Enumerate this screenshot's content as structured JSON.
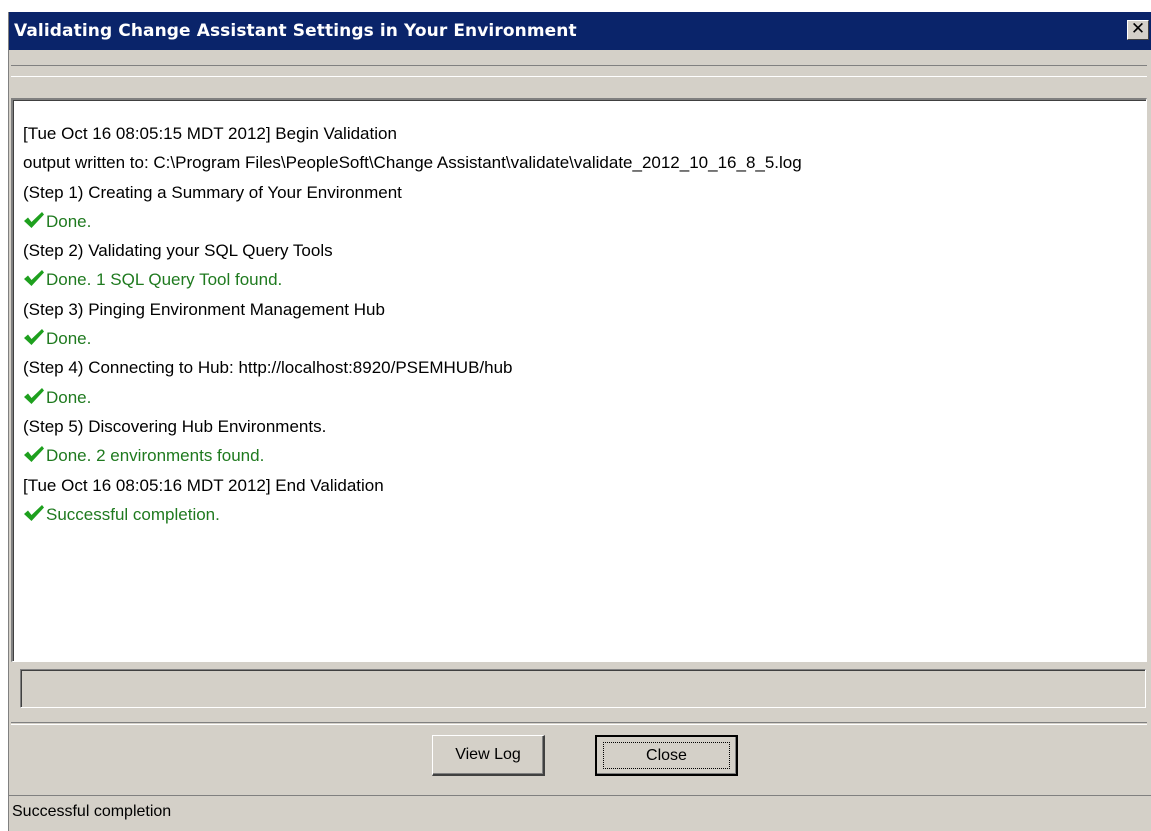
{
  "window": {
    "title": "Validating Change Assistant Settings in Your Environment",
    "close_glyph": "✕"
  },
  "log": {
    "lines": [
      {
        "text": "[Tue Oct 16 08:05:15 MDT 2012] Begin Validation",
        "status": "info"
      },
      {
        "text": "output written to: C:\\Program Files\\PeopleSoft\\Change Assistant\\validate\\validate_2012_10_16_8_5.log",
        "status": "info"
      },
      {
        "text": "(Step 1) Creating a Summary of Your Environment",
        "status": "info"
      },
      {
        "text": "Done.",
        "status": "done",
        "icon": "checkmark-icon"
      },
      {
        "text": "(Step 2) Validating your SQL Query Tools",
        "status": "info"
      },
      {
        "text": "Done.  1 SQL Query Tool found.",
        "status": "done",
        "icon": "checkmark-icon"
      },
      {
        "text": "(Step 3) Pinging Environment Management Hub",
        "status": "info"
      },
      {
        "text": "Done.",
        "status": "done",
        "icon": "checkmark-icon"
      },
      {
        "text": "(Step 4) Connecting to Hub: http://localhost:8920/PSEMHUB/hub",
        "status": "info"
      },
      {
        "text": "Done.",
        "status": "done",
        "icon": "checkmark-icon"
      },
      {
        "text": "(Step 5) Discovering Hub Environments.",
        "status": "info"
      },
      {
        "text": "Done.  2 environments found.",
        "status": "done",
        "icon": "checkmark-icon"
      },
      {
        "text": "[Tue Oct 16 08:05:16 MDT 2012] End Validation",
        "status": "info"
      },
      {
        "text": "Successful completion.",
        "status": "done",
        "icon": "checkmark-icon"
      }
    ]
  },
  "buttons": {
    "view_log": "View Log",
    "close": "Close"
  },
  "status_bar": {
    "text": "Successful completion"
  },
  "colors": {
    "title_bar": "#0a246a",
    "done_text": "#1f7a1f",
    "checkmark": "#1ea01e",
    "dialog_face": "#d4d0c8"
  }
}
